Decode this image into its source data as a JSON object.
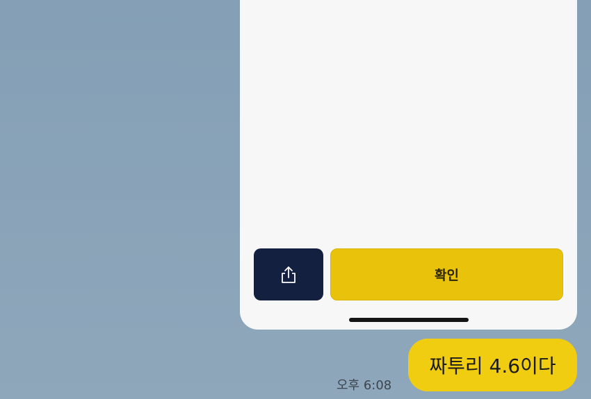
{
  "screenshot_card": {
    "confirm_label": "확인",
    "share_icon": "share-upload-icon"
  },
  "message": {
    "text": "짜투리 4.6이다",
    "time": "오후 6:08"
  },
  "colors": {
    "background": "#8aa3b8",
    "card": "#f7f7f7",
    "share_button": "#14203f",
    "confirm_button": "#e9c30b",
    "bubble": "#f1cd12"
  }
}
